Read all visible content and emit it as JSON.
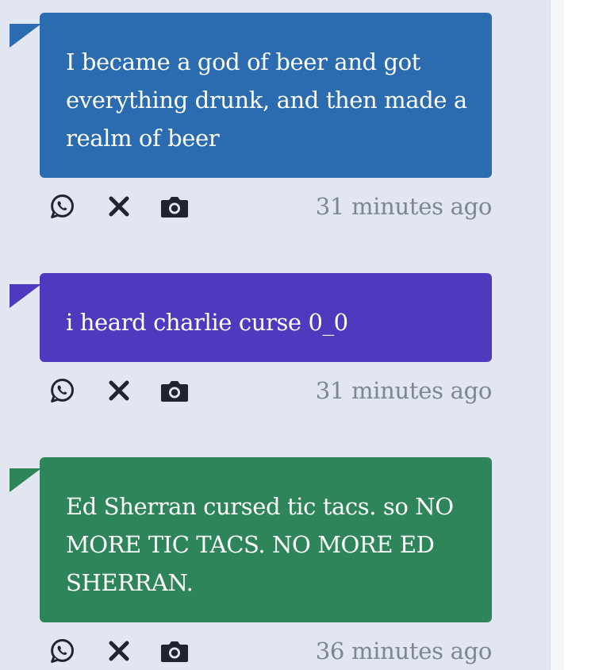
{
  "posts": [
    {
      "text": "I became a god of beer and got everything drunk, and then made a realm of beer",
      "time": "31 minutes ago",
      "color": "#2b6cb0"
    },
    {
      "text": "i heard charlie curse 0_0",
      "time": "31 minutes ago",
      "color": "#4f39bf"
    },
    {
      "text": "Ed Sherran cursed tic tacs. so NO MORE TIC TACS. NO MORE ED SHERRAN.",
      "time": "36 minutes ago",
      "color": "#2f855a"
    }
  ],
  "icons": {
    "share_whatsapp": "whatsapp-icon",
    "share_x": "x-icon",
    "screenshot": "camera-icon"
  }
}
